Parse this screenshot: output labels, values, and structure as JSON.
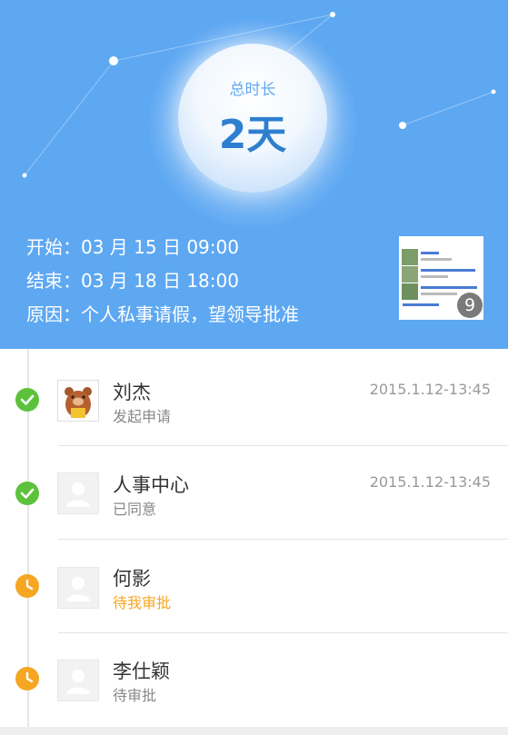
{
  "summary": {
    "duration_label": "总时长",
    "duration_value": "2天",
    "start_label": "开始：",
    "start_value": "03 月 15 日 09:00",
    "end_label": "结束：",
    "end_value": "03 月 18 日 18:00",
    "reason_label": "原因：",
    "reason_value": "个人私事请假，望领导批准",
    "attachment_count": "9"
  },
  "approvals": [
    {
      "name": "刘杰",
      "status": "发起申请",
      "time": "2015.1.12-13:45",
      "state": "done",
      "avatar": "bear-avatar"
    },
    {
      "name": "人事中心",
      "status": "已同意",
      "time": "2015.1.12-13:45",
      "state": "done",
      "avatar": "default-avatar"
    },
    {
      "name": "何影",
      "status": "待我审批",
      "time": "",
      "state": "pending",
      "avatar": "default-avatar"
    },
    {
      "name": "李仕颖",
      "status": "待审批",
      "time": "",
      "state": "pending",
      "avatar": "default-avatar"
    }
  ],
  "colors": {
    "header_bg": "#5ea8f2",
    "done_green": "#5cc23c",
    "pending_orange": "#f5a623"
  }
}
